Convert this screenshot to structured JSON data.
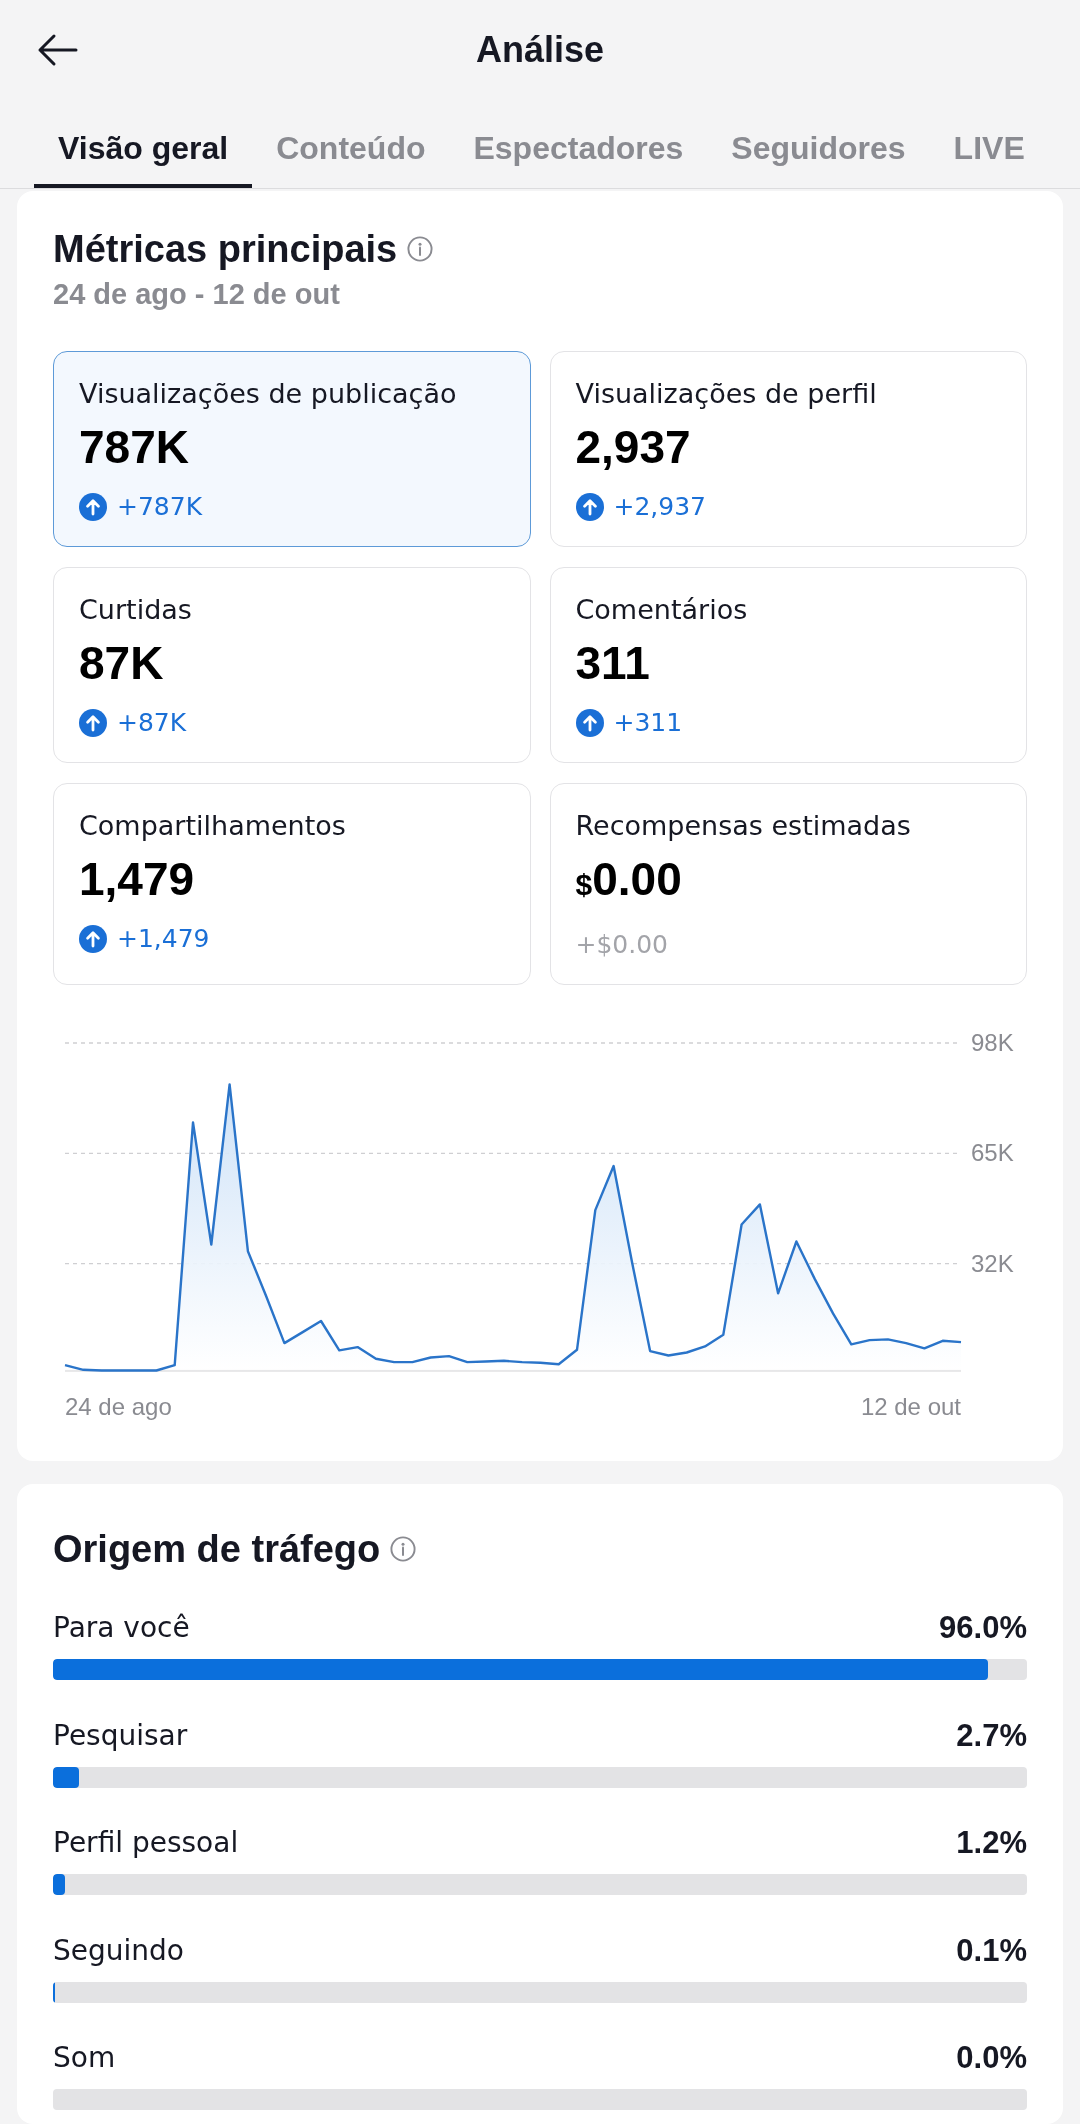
{
  "header": {
    "title": "Análise"
  },
  "tabs": [
    {
      "label": "Visão geral",
      "selected": true
    },
    {
      "label": "Conteúdo",
      "selected": false
    },
    {
      "label": "Espectadores",
      "selected": false
    },
    {
      "label": "Seguidores",
      "selected": false
    },
    {
      "label": "LIVE",
      "selected": false
    }
  ],
  "key_metrics": {
    "title": "Métricas principais",
    "date_range": "24 de ago - 12 de out",
    "metrics": [
      {
        "label": "Visualizações de publicação",
        "value": "787K",
        "change": "+787K",
        "kind": "up",
        "selected": true
      },
      {
        "label": "Visualizações de perfil",
        "value": "2,937",
        "change": "+2,937",
        "kind": "up",
        "selected": false
      },
      {
        "label": "Curtidas",
        "value": "87K",
        "change": "+87K",
        "kind": "up",
        "selected": false
      },
      {
        "label": "Comentários",
        "value": "311",
        "change": "+311",
        "kind": "up",
        "selected": false
      },
      {
        "label": "Compartilhamentos",
        "value": "1,479",
        "change": "+1,479",
        "kind": "up",
        "selected": false
      },
      {
        "label": "Recompensas estimadas",
        "currency": "$",
        "value": "0.00",
        "change": "+$0.00",
        "kind": "flat",
        "selected": false
      }
    ],
    "chart_data": {
      "type": "area",
      "ylim": [
        0,
        98000
      ],
      "yticks": [
        {
          "value": 32000,
          "label": "32K"
        },
        {
          "value": 65000,
          "label": "65K"
        },
        {
          "value": 98000,
          "label": "98K"
        }
      ],
      "values": [
        1600,
        200,
        0,
        0,
        0,
        0,
        1600,
        74200,
        37700,
        85600,
        35700,
        22300,
        8200,
        11500,
        14800,
        6000,
        7000,
        3500,
        2500,
        2500,
        3900,
        4300,
        2500,
        2700,
        2900,
        2500,
        2300,
        1900,
        6200,
        48000,
        61200,
        32600,
        5800,
        4500,
        5400,
        7200,
        10700,
        43700,
        49700,
        23100,
        38600,
        27400,
        17100,
        7800,
        9100,
        9300,
        8200,
        6600,
        8900,
        8500
      ]
    },
    "chart_dates": [
      "24 de ago",
      "12 de out"
    ]
  },
  "traffic_sources": {
    "title": "Origem de tráfego",
    "items": [
      {
        "label": "Para você",
        "value": "96.0%",
        "level": 0.96
      },
      {
        "label": "Pesquisar",
        "value": "2.7%",
        "level": 0.027
      },
      {
        "label": "Perfil pessoal",
        "value": "1.2%",
        "level": 0.012
      },
      {
        "label": "Seguindo",
        "value": "0.1%",
        "level": 0.001
      },
      {
        "label": "Som",
        "value": "0.0%"
      }
    ]
  }
}
